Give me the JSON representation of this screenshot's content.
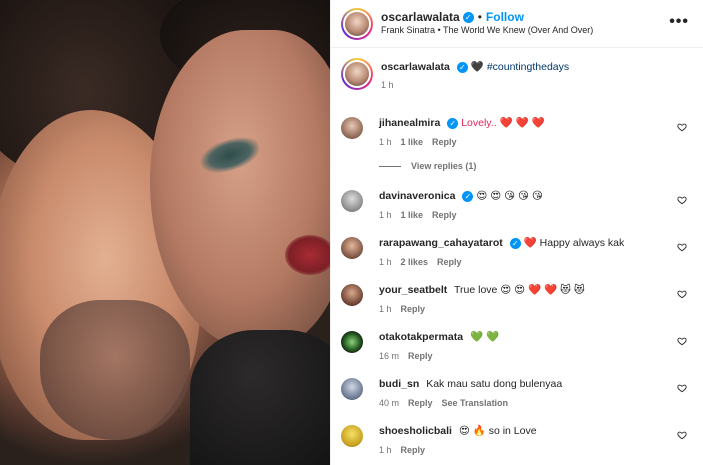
{
  "post": {
    "username": "oscarlawalata",
    "follow_label": "Follow",
    "song": "Frank Sinatra • The World We Knew (Over And Over)",
    "more_label": "•••",
    "dot": "•"
  },
  "caption": {
    "username": "oscarlawalata",
    "text_prefix": "🖤",
    "hashtag": "#countingthedays",
    "time": "1 h"
  },
  "comments": [
    {
      "username": "jihanealmira",
      "verified": true,
      "text": "Lovely.. ❤️ ❤️ ❤️",
      "time": "1 h",
      "likes": "1 like",
      "reply": "Reply",
      "view_replies": "View replies (1)"
    },
    {
      "username": "davinaveronica",
      "verified": true,
      "text": "😍 😍 😘 😘 😘",
      "time": "1 h",
      "likes": "1 like",
      "reply": "Reply"
    },
    {
      "username": "rarapawang_cahayatarot",
      "verified": true,
      "text": "❤️ Happy always kak",
      "time": "1 h",
      "likes": "2 likes",
      "reply": "Reply"
    },
    {
      "username": "your_seatbelt",
      "verified": false,
      "text": "True love 😍 😍 ❤️ ❤️ 😻 😻",
      "time": "1 h",
      "reply": "Reply"
    },
    {
      "username": "otakotakpermata",
      "verified": false,
      "text": "💚 💚",
      "time": "16 m",
      "reply": "Reply"
    },
    {
      "username": "budi_sn",
      "verified": false,
      "text": "Kak mau satu dong bulenyaa",
      "time": "40 m",
      "reply": "Reply",
      "translate": "See Translation"
    },
    {
      "username": "shoesholicbali",
      "verified": false,
      "text": "😍 🔥 so in Love",
      "time": "1 h",
      "reply": "Reply"
    }
  ],
  "colors": {
    "accent": "#0095f6",
    "hashtag": "#00376b",
    "muted": "#737373"
  }
}
